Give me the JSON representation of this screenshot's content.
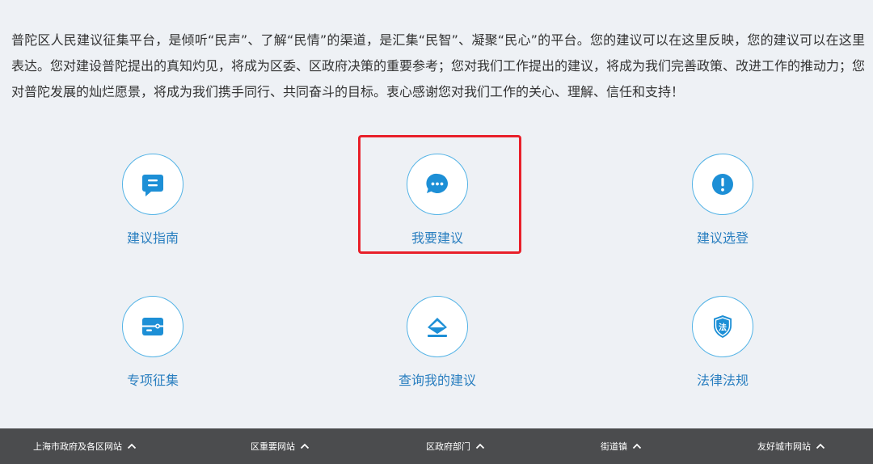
{
  "intro": {
    "text": "普陀区人民建议征集平台，是倾听“民声”、了解“民情”的渠道，是汇集“民智”、凝聚“民心”的平台。您的建议可以在这里反映，您的建议可以在这里表达。您对建设普陀提出的真知灼见，将成为区委、区政府决策的重要参考；您对我们工作提出的建议，将成为我们完善政策、改进工作的推动力；您对普陀发展的灿烂愿景，将成为我们携手同行、共同奋斗的目标。衷心感谢您对我们工作的关心、理解、信任和支持！"
  },
  "menu": [
    {
      "label": "建议指南",
      "icon": "document-icon"
    },
    {
      "label": "我要建议",
      "icon": "chat-bubble-icon"
    },
    {
      "label": "建议选登",
      "icon": "exclamation-icon"
    },
    {
      "label": "专项征集",
      "icon": "folder-icon"
    },
    {
      "label": "查询我的建议",
      "icon": "envelope-icon"
    },
    {
      "label": "法律法规",
      "icon": "law-shield-icon"
    }
  ],
  "footer": {
    "links": [
      {
        "label": "上海市政府及各区网站"
      },
      {
        "label": "区重要网站"
      },
      {
        "label": "区政府部门"
      },
      {
        "label": "街道镇"
      },
      {
        "label": "友好城市网站"
      }
    ]
  },
  "colors": {
    "accent": "#1d8fd6",
    "label": "#2a7fc0",
    "highlight": "#e8202a",
    "footer_bg": "#4b4c4e",
    "background": "#eef1f5"
  }
}
